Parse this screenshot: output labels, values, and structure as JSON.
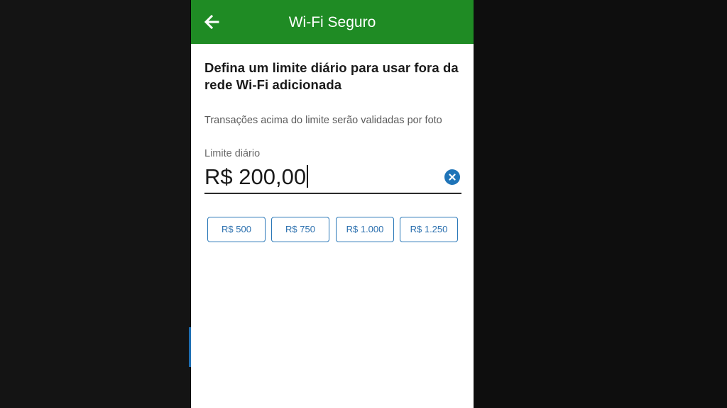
{
  "appbar": {
    "title": "Wi-Fi Seguro",
    "back_icon": "arrow-left-icon",
    "color": "#1f8b24"
  },
  "content": {
    "heading": "Defina um limite diário para usar fora da rede Wi-Fi adicionada",
    "subtitle": "Transações acima do limite serão validadas por foto"
  },
  "limit_field": {
    "label": "Limite diário",
    "value": "R$ 200,00",
    "clear_icon": "clear-circle-icon",
    "accent_color": "#1f74b8"
  },
  "quick_amounts": [
    {
      "label": "R$ 500"
    },
    {
      "label": "R$ 750"
    },
    {
      "label": "R$ 1.000"
    },
    {
      "label": "R$ 1.250"
    }
  ]
}
